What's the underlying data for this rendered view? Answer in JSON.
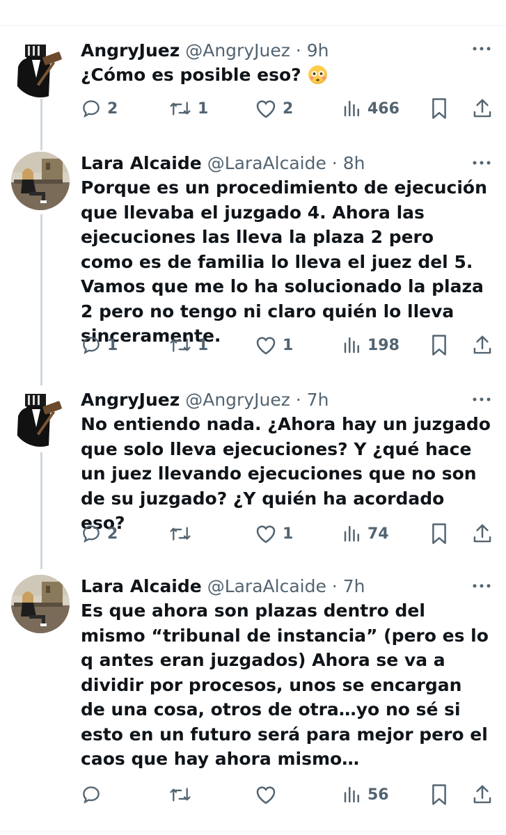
{
  "tweets": [
    {
      "name": "AngryJuez",
      "handle": "@AngryJuez",
      "time": "· 9h",
      "text": "¿Cómo es posible eso?",
      "emoji": "flushed-face-emoji",
      "replies": "2",
      "retweets": "1",
      "likes": "2",
      "views": "466"
    },
    {
      "name": "Lara Alcaide",
      "handle": "@LaraAlcaide",
      "time": "· 8h",
      "text": "Porque es un procedimiento de ejecución que llevaba el juzgado 4. Ahora las ejecuciones las lleva la plaza 2 pero como es de familia lo lleva el juez del 5. Vamos que me lo ha solucionado la plaza 2 pero no tengo ni claro quién lo lleva sinceramente.",
      "replies": "1",
      "retweets": "1",
      "likes": "1",
      "views": "198"
    },
    {
      "name": "AngryJuez",
      "handle": "@AngryJuez",
      "time": "· 7h",
      "text": "No entiendo nada. ¿Ahora hay un juzgado que solo lleva ejecuciones? Y ¿qué hace un juez llevando ejecuciones que no son de su juzgado? ¿Y quién ha acordado eso?",
      "replies": "2",
      "retweets": "",
      "likes": "1",
      "views": "74"
    },
    {
      "name": "Lara Alcaide",
      "handle": "@LaraAlcaide",
      "time": "· 7h",
      "text": "Es que ahora son plazas dentro del mismo “tribunal de instancia” (pero es lo q antes eran juzgados) Ahora se va a dividir por procesos, unos se encargan de una cosa, otros de otra…yo no sé si esto en un futuro será para mejor pero el caos que hay ahora mismo…",
      "replies": "",
      "retweets": "",
      "likes": "",
      "views": "56"
    }
  ],
  "colors": {
    "text": "#0f1419",
    "muted": "#536471",
    "thread_line": "#cfd9de",
    "divider": "#eff3f4"
  },
  "icons": [
    "reply-icon",
    "retweet-icon",
    "like-icon",
    "views-icon",
    "bookmark-icon",
    "share-icon",
    "more-icon"
  ]
}
